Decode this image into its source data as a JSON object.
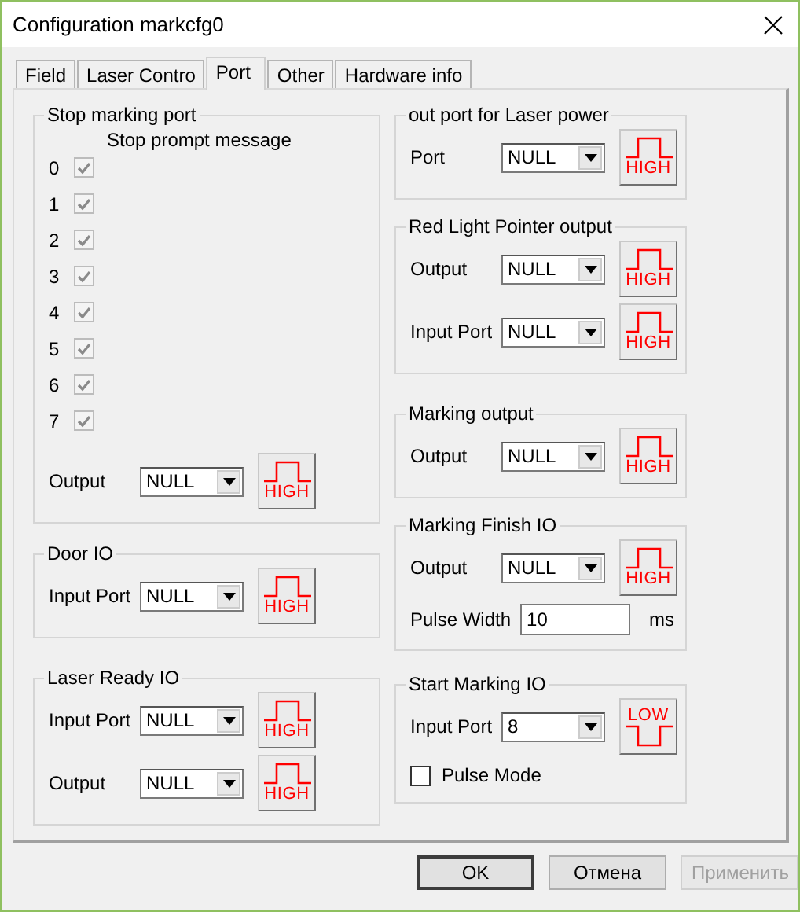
{
  "window": {
    "title": "Configuration markcfg0"
  },
  "tabs": [
    {
      "label": "Field",
      "selected": false
    },
    {
      "label": "Laser Contro",
      "selected": false
    },
    {
      "label": "Port",
      "selected": true
    },
    {
      "label": "Other",
      "selected": false
    },
    {
      "label": "Hardware info",
      "selected": false
    }
  ],
  "left_groups": [
    {
      "title": "Stop marking port",
      "caption": "Stop prompt message",
      "checkboxes": [
        {
          "label": "0",
          "checked": true,
          "disabled": true
        },
        {
          "label": "1",
          "checked": true,
          "disabled": true
        },
        {
          "label": "2",
          "checked": true,
          "disabled": true
        },
        {
          "label": "3",
          "checked": true,
          "disabled": true
        },
        {
          "label": "4",
          "checked": true,
          "disabled": true
        },
        {
          "label": "5",
          "checked": true,
          "disabled": true
        },
        {
          "label": "6",
          "checked": true,
          "disabled": true
        },
        {
          "label": "7",
          "checked": true,
          "disabled": true
        }
      ],
      "rows": [
        {
          "kind": "combo",
          "label": "Output",
          "value": "NULL",
          "signal": {
            "kind": "high",
            "text": "HIGH"
          }
        }
      ]
    },
    {
      "title": "Door IO",
      "rows": [
        {
          "kind": "combo",
          "label": "Input Port",
          "value": "NULL",
          "signal": {
            "kind": "high",
            "text": "HIGH"
          }
        }
      ]
    },
    {
      "title": "Laser Ready IO",
      "rows": [
        {
          "kind": "combo",
          "label": "Input Port",
          "value": "NULL",
          "signal": {
            "kind": "high",
            "text": "HIGH"
          }
        },
        {
          "kind": "combo",
          "label": "Output",
          "value": "NULL",
          "signal": {
            "kind": "high",
            "text": "HIGH"
          }
        }
      ]
    }
  ],
  "right_groups": [
    {
      "title": "out port for Laser power",
      "rows": [
        {
          "kind": "combo",
          "label": "Port",
          "value": "NULL",
          "signal": {
            "kind": "high",
            "text": "HIGH"
          }
        }
      ]
    },
    {
      "title": "Red Light Pointer output",
      "rows": [
        {
          "kind": "combo",
          "label": "Output",
          "value": "NULL",
          "signal": {
            "kind": "high",
            "text": "HIGH"
          }
        },
        {
          "kind": "combo",
          "label": "Input Port",
          "value": "NULL",
          "signal": {
            "kind": "high",
            "text": "HIGH"
          }
        }
      ]
    },
    {
      "title": "Marking output",
      "rows": [
        {
          "kind": "combo",
          "label": "Output",
          "value": "NULL",
          "signal": {
            "kind": "high",
            "text": "HIGH"
          }
        }
      ]
    },
    {
      "title": "Marking Finish IO",
      "rows": [
        {
          "kind": "combo",
          "label": "Output",
          "value": "NULL",
          "signal": {
            "kind": "high",
            "text": "HIGH"
          }
        },
        {
          "kind": "text",
          "label": "Pulse Width",
          "value": "10",
          "unit": "ms"
        }
      ]
    },
    {
      "title": "Start Marking IO",
      "rows": [
        {
          "kind": "combo",
          "label": "Input Port",
          "value": "8",
          "signal": {
            "kind": "low",
            "text": "LOW"
          }
        },
        {
          "kind": "check",
          "label": "Pulse Mode",
          "checked": false
        }
      ]
    }
  ],
  "buttons": [
    {
      "label": "OK",
      "disabled": false
    },
    {
      "label": "Отмена",
      "disabled": false
    },
    {
      "label": "Применить",
      "disabled": true
    }
  ]
}
